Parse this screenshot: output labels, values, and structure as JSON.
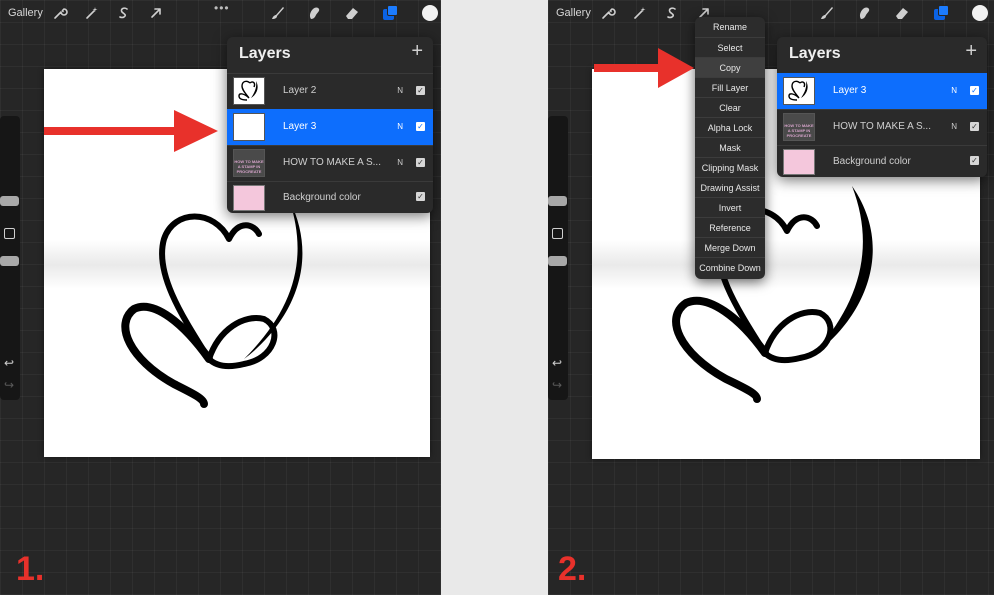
{
  "toolbar": {
    "gallery_label": "Gallery",
    "more_label": "•••",
    "icons": [
      "wrench-icon",
      "magic-wand-icon",
      "selection-s-icon",
      "arrow-transform-icon",
      "brush-icon",
      "smudge-icon",
      "eraser-icon",
      "layers-icon",
      "color-swatch"
    ],
    "layers_icon_color": "#0a63e6",
    "current_color": "#f2f2f2"
  },
  "sidebar": {
    "undo_glyph": "↩",
    "redo_glyph": "↪"
  },
  "panel1": {
    "layers_title": "Layers",
    "add_glyph": "+",
    "layers": [
      {
        "name": "Layer 2",
        "mode": "N",
        "checked": "✓",
        "selected": false,
        "thumb": "heart"
      },
      {
        "name": "Layer 3",
        "mode": "N",
        "checked": "✓",
        "selected": true,
        "thumb": "blank"
      },
      {
        "name": "HOW TO MAKE A S...",
        "mode": "N",
        "checked": "✓",
        "selected": false,
        "thumb": "text",
        "thumb_text": "HOW TO MAKE A STAMP IN PROCREATE"
      },
      {
        "name": "Background color",
        "mode": "",
        "checked": "✓",
        "selected": false,
        "thumb": "color"
      }
    ],
    "step_label": "1."
  },
  "panel2": {
    "layers_title": "Layers",
    "add_glyph": "+",
    "layers": [
      {
        "name": "Layer 3",
        "mode": "N",
        "checked": "✓",
        "selected": true,
        "thumb": "heart"
      },
      {
        "name": "HOW TO MAKE A S...",
        "mode": "N",
        "checked": "✓",
        "selected": false,
        "thumb": "text",
        "thumb_text": "HOW TO MAKE A STAMP IN PROCREATE"
      },
      {
        "name": "Background color",
        "mode": "",
        "checked": "✓",
        "selected": false,
        "thumb": "color"
      }
    ],
    "context_menu": [
      "Rename",
      "Select",
      "Copy",
      "Fill Layer",
      "Clear",
      "Alpha Lock",
      "Mask",
      "Clipping Mask",
      "Drawing Assist",
      "Invert",
      "Reference",
      "Merge Down",
      "Combine Down"
    ],
    "step_label": "2."
  },
  "colors": {
    "selected_layer": "#0d6efd",
    "background_layer": "#f4c7dc",
    "arrow": "#e8312b"
  }
}
